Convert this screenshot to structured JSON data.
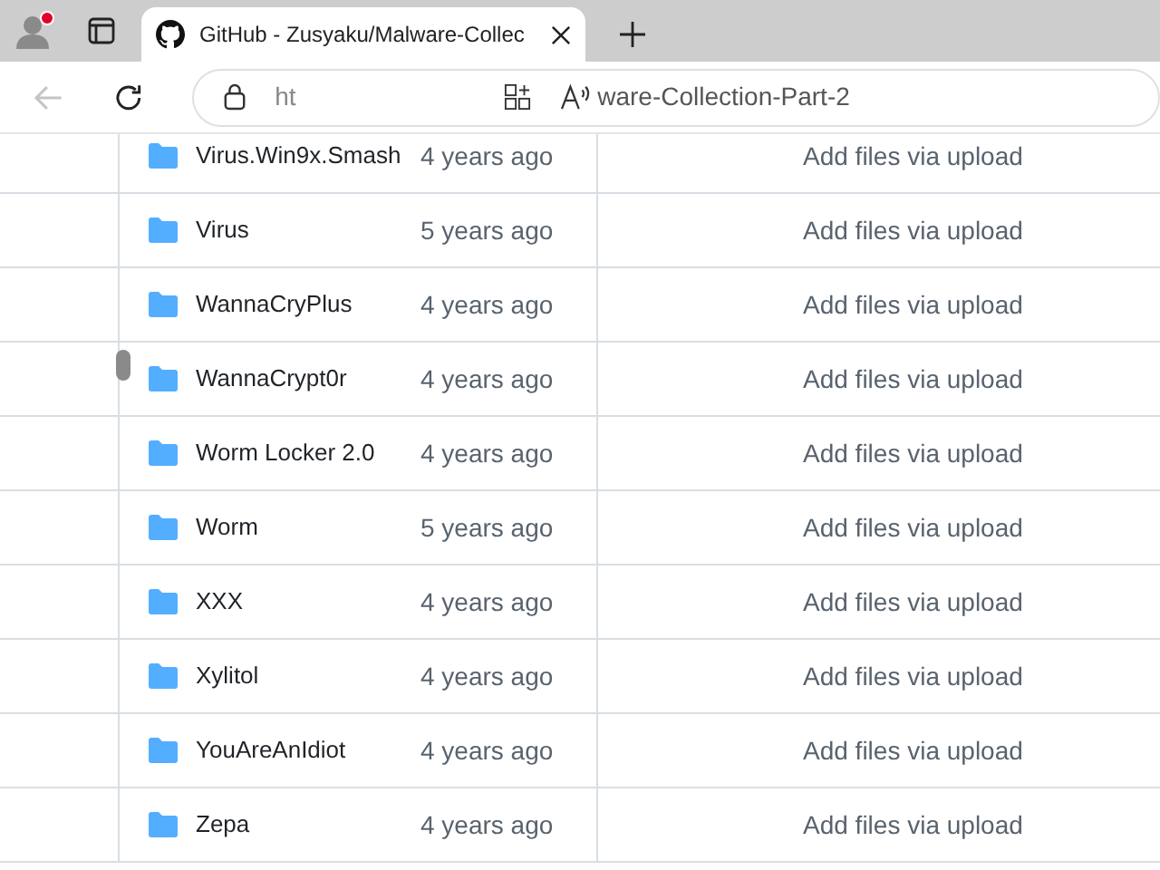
{
  "browser": {
    "tab_title": "GitHub - Zusyaku/Malware-Collec",
    "url_start": "ht",
    "url_end": "ware-Collection-Part-2"
  },
  "files": [
    {
      "name": "Virus.Win9x.Smash",
      "age": "4 years ago",
      "message": "Add files via upload"
    },
    {
      "name": "Virus",
      "age": "5 years ago",
      "message": "Add files via upload"
    },
    {
      "name": "WannaCryPlus",
      "age": "4 years ago",
      "message": "Add files via upload"
    },
    {
      "name": "WannaCrypt0r",
      "age": "4 years ago",
      "message": "Add files via upload"
    },
    {
      "name": "Worm Locker 2.0",
      "age": "4 years ago",
      "message": "Add files via upload"
    },
    {
      "name": "Worm",
      "age": "5 years ago",
      "message": "Add files via upload"
    },
    {
      "name": "XXX",
      "age": "4 years ago",
      "message": "Add files via upload"
    },
    {
      "name": "Xylitol",
      "age": "4 years ago",
      "message": "Add files via upload"
    },
    {
      "name": "YouAreAnIdiot",
      "age": "4 years ago",
      "message": "Add files via upload"
    },
    {
      "name": "Zepa",
      "age": "4 years ago",
      "message": "Add files via upload"
    }
  ]
}
